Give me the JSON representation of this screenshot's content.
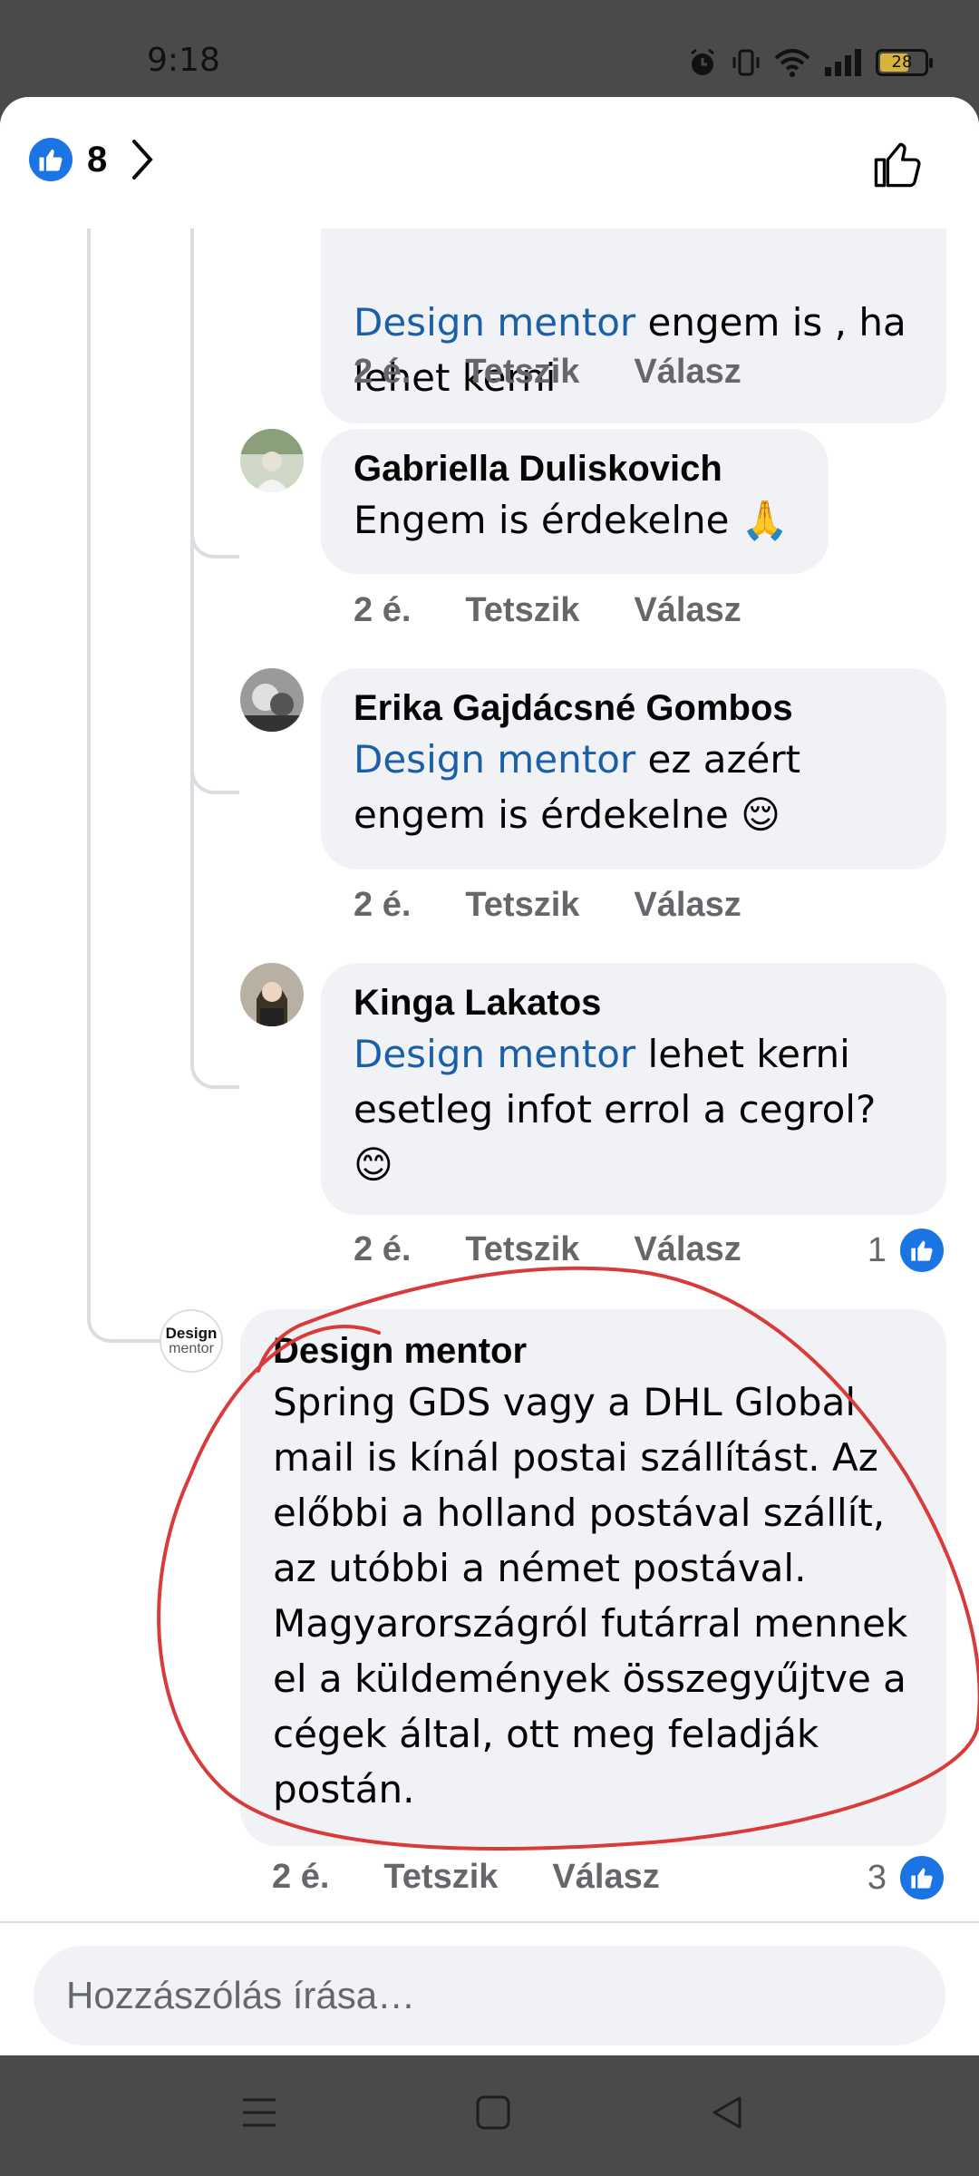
{
  "status_bar": {
    "time": "9:18",
    "battery": "28",
    "icons": [
      "alarm-icon",
      "vibrate-icon",
      "wifi-icon",
      "signal-icon",
      "battery-icon"
    ]
  },
  "header": {
    "reaction_count": "8",
    "accent": "#1b74e4"
  },
  "comments": [
    {
      "author": "",
      "mention": "Design mentor",
      "text_after_mention": " engem is , ha",
      "text_line2": "lehet kerni",
      "time": "2 é.",
      "like_label": "Tetszik",
      "reply_label": "Válasz"
    },
    {
      "author": "Gabriella Duliskovich",
      "text": "Engem is érdekelne 🙏",
      "time": "2 é.",
      "like_label": "Tetszik",
      "reply_label": "Válasz"
    },
    {
      "author": "Erika Gajdácsné Gombos",
      "mention": "Design mentor",
      "text_after_mention": " ez azért",
      "text_line2": "engem is érdekelne 😌",
      "time": "2 é.",
      "like_label": "Tetszik",
      "reply_label": "Válasz"
    },
    {
      "author": "Kinga Lakatos",
      "mention": "Design mentor",
      "text_after_mention": " lehet kerni",
      "text_line2": "esetleg infot errol a cegrol?",
      "text_line3": "😊",
      "time": "2 é.",
      "like_label": "Tetszik",
      "reply_label": "Válasz",
      "reactions": "1"
    },
    {
      "author": "Design mentor",
      "avatar_text_1": "Design",
      "avatar_text_2": "mentor",
      "lines": [
        "Spring GDS vagy a DHL Global",
        "mail is kínál postai szállítást. Az",
        "előbbi a holland postával szállít,",
        "az utóbbi a német postával.",
        "Magyarországról futárral mennek",
        "el a küldemények összegyűjtve a",
        "cégek által, ott meg feladják",
        "postán."
      ],
      "time": "2 é.",
      "like_label": "Tetszik",
      "reply_label": "Válasz",
      "reactions": "3"
    }
  ],
  "composer": {
    "placeholder": "Hozzászólás írása…"
  },
  "nav": {
    "icons": [
      "menu-icon",
      "home-icon",
      "back-icon"
    ]
  },
  "annotation_color": "#d93a3a"
}
